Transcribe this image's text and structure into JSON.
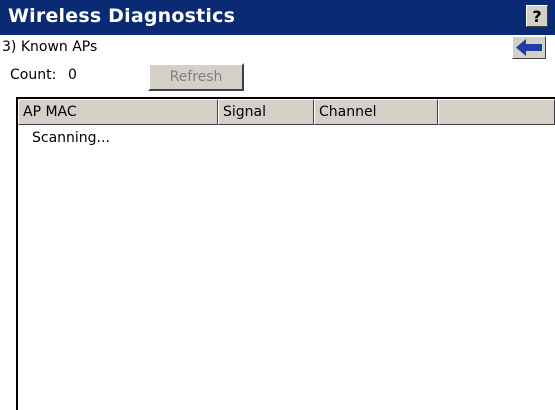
{
  "window": {
    "title": "Wireless Diagnostics",
    "help_label": "?"
  },
  "subheader": {
    "label": "3) Known APs"
  },
  "toolbar": {
    "count_label": "Count:",
    "count_value": "0",
    "refresh_label": "Refresh"
  },
  "table": {
    "columns": [
      "AP MAC",
      "Signal",
      "Channel",
      ""
    ],
    "status_text": "Scanning..."
  },
  "colors": {
    "titlebar": "#0a2a73",
    "button_face": "#d4d0c8",
    "back_arrow": "#1f3ea8"
  },
  "icons": {
    "back": "left-arrow-icon"
  }
}
